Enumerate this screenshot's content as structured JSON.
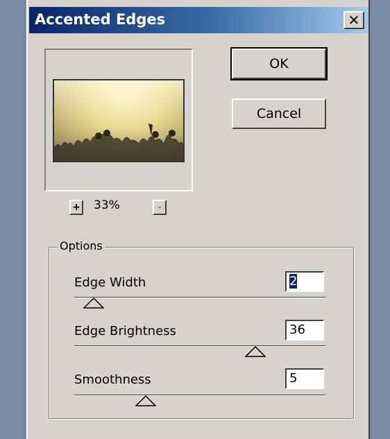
{
  "dialog": {
    "title": "Accented Edges",
    "close_icon": "close-icon",
    "ok_label": "OK",
    "cancel_label": "Cancel"
  },
  "preview": {
    "zoom_in_label": "+",
    "zoom_level": "33%",
    "zoom_out_label": "-"
  },
  "options": {
    "legend": "Options",
    "edge_width": {
      "label": "Edge Width",
      "value": "2",
      "min": 1,
      "max": 14
    },
    "edge_brightness": {
      "label": "Edge Brightness",
      "value": "36",
      "min": 0,
      "max": 50
    },
    "smoothness": {
      "label": "Smoothness",
      "value": "5",
      "min": 1,
      "max": 15
    }
  },
  "colors": {
    "title_bar_start": "#0a246a",
    "title_bar_end": "#a6caf0",
    "dialog_face": "#d6d3ce",
    "desktop": "#7b8aa5"
  }
}
